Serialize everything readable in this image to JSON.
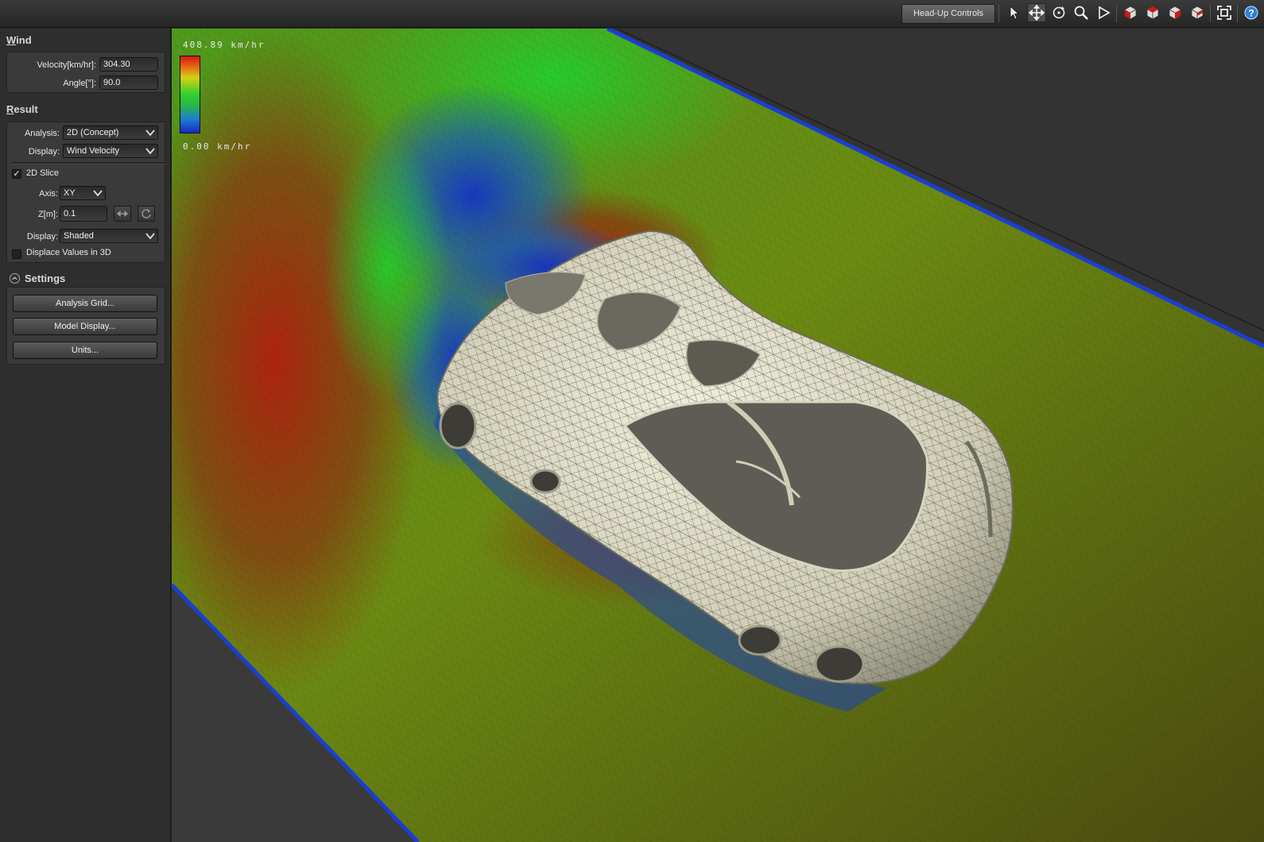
{
  "toolbar": {
    "hud_label": "Head-Up Controls",
    "icons": [
      "select-arrow-icon",
      "pan-icon",
      "orbit-icon",
      "zoom-icon",
      "play-icon",
      "view-cube-front-icon",
      "view-cube-top-icon",
      "view-cube-side-icon",
      "view-cube-iso-icon",
      "fit-view-icon",
      "help-icon"
    ]
  },
  "wind": {
    "title": "Wind",
    "velocity_label": "Velocity[km/hr]:",
    "velocity_value": "304.30",
    "angle_label": "Angle[°]:",
    "angle_value": "90.0"
  },
  "result": {
    "title": "Result",
    "analysis_label": "Analysis:",
    "analysis_value": "2D (Concept)",
    "display_label": "Display:",
    "display_value": "Wind Velocity",
    "slice_label": "2D Slice",
    "slice_checked": true,
    "axis_label": "Axis:",
    "axis_value": "XY",
    "z_label": "Z[m]:",
    "z_value": "0.1",
    "display2_label": "Display:",
    "display2_value": "Shaded",
    "displace_label": "Displace Values in 3D",
    "displace_checked": false
  },
  "settings": {
    "title": "Settings",
    "buttons": [
      "Analysis Grid...",
      "Model Display...",
      "Units..."
    ]
  },
  "legend": {
    "max": "408.89 km/hr",
    "min": "0.00 km/hr"
  },
  "colors": {
    "accent_red": "#cc1b1b",
    "scale_high": "#d31b10",
    "scale_mid": "#2fd12c",
    "scale_low": "#1828c8",
    "car_body": "#d8d6c0"
  }
}
